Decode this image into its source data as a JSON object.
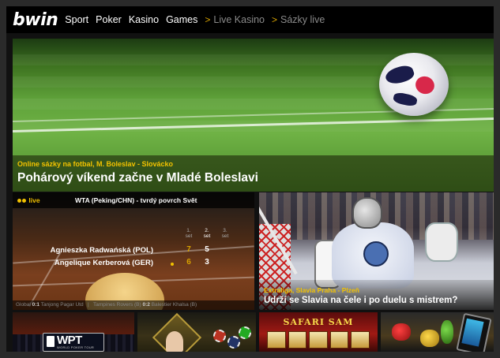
{
  "brand": {
    "logo": "bwin"
  },
  "nav": {
    "items": [
      {
        "label": "Sport"
      },
      {
        "label": "Poker"
      },
      {
        "label": "Kasino"
      },
      {
        "label": "Games"
      }
    ],
    "extra": [
      {
        "prefix": ">",
        "label": "Live Kasino"
      },
      {
        "prefix": ">",
        "label": "Sázky live"
      }
    ]
  },
  "hero": {
    "kicker": "Online sázky na fotbal, M. Boleslav - Slovácko",
    "title": "Pohárový víkend začne v Mladé Boleslavi"
  },
  "live_match": {
    "badge": "live",
    "title": "WTA (Peking/CHN) - tvrdý povrch Svět",
    "set_labels": [
      "1.",
      "2.",
      "3."
    ],
    "set_word": "set",
    "players": [
      {
        "name": "Agnieszka Radwańská (POL)",
        "s1": "7",
        "s2": "5",
        "serving": false
      },
      {
        "name": "Angelique Kerberová (GER)",
        "s1": "6",
        "s2": "3",
        "serving": true
      }
    ],
    "ticker": [
      {
        "label": "Global",
        "score": "0:1",
        "teams": "Tanjong Pagar Utd"
      },
      {
        "label": "|",
        "score": "",
        "teams": "Tampines Rovers (B)"
      },
      {
        "label": "",
        "score": "0:2",
        "teams": "Balestier Khalsa (B)"
      }
    ]
  },
  "story2": {
    "kicker": "Extraliga, Slavia Praha - Plzeň",
    "title": "Udrží se Slavia na čele i po duelu s mistrem?"
  },
  "tiles": {
    "wpt": {
      "logo": "WPT",
      "sub": "WORLD POKER TOUR"
    },
    "safari": {
      "logo": "SAFARI SAM"
    }
  },
  "colors": {
    "accent": "#f2c200",
    "nav_bg": "#000000"
  }
}
